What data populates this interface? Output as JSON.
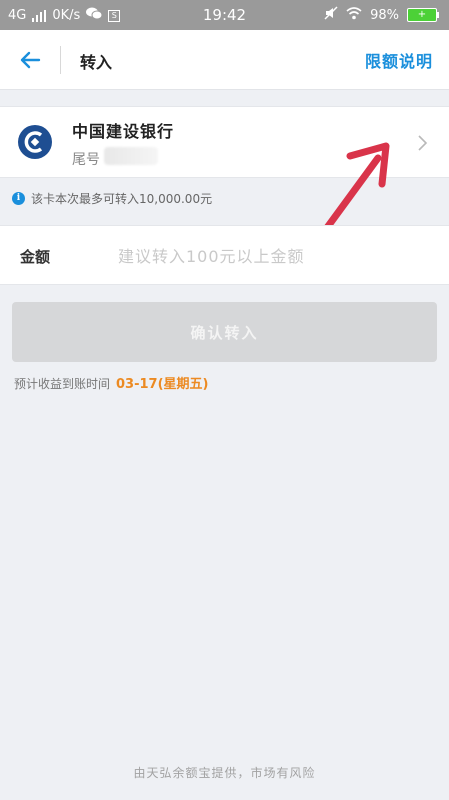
{
  "status_bar": {
    "network": "4G",
    "speed": "0K/s",
    "time": "19:42",
    "battery": "98%",
    "icons": [
      "signal-icon",
      "wechat-icon",
      "app-icon",
      "mute-icon",
      "wifi-icon",
      "battery-icon"
    ]
  },
  "nav": {
    "title": "转入",
    "limit_link": "限额说明",
    "back_icon": "back-arrow-icon"
  },
  "bank_card": {
    "name": "中国建设银行",
    "tail_label": "尾号",
    "logo": "ccb-logo-icon",
    "logo_color": "#1e4e92"
  },
  "notice": {
    "text": "该卡本次最多可转入10,000.00元"
  },
  "amount": {
    "label": "金额",
    "placeholder": "建议转入100元以上金额"
  },
  "confirm": {
    "label": "确认转入"
  },
  "arrival": {
    "label": "预计收益到账时间",
    "date": "03-17(星期五)"
  },
  "footer": {
    "text": "由天弘余额宝提供，市场有风险"
  },
  "colors": {
    "accent": "#1a8fdc",
    "date": "#ec8a22",
    "annotation_arrow": "#d9344a"
  }
}
